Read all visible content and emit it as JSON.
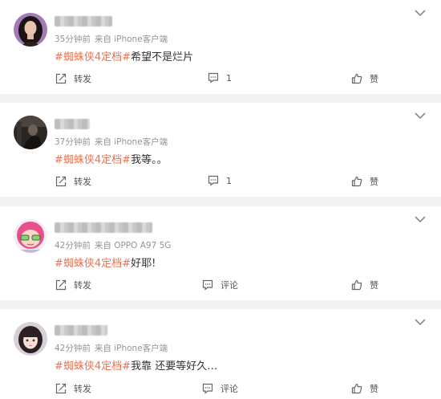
{
  "colors": {
    "hashtag": "#eb7350",
    "meta": "#939393",
    "background": "#f2f2f2"
  },
  "posts": [
    {
      "avatar": "avatar-dark-hair-woman",
      "time": "35分钟前",
      "source": "来自 iPhone客户端",
      "hashtag": "#蜘蛛侠4定档#",
      "text": "希望不是烂片",
      "repost_label": "转发",
      "comment_label": "1",
      "like_label": "赞"
    },
    {
      "avatar": "avatar-dark-figure",
      "time": "37分钟前",
      "source": "来自 iPhone客户端",
      "hashtag": "#蜘蛛侠4定档#",
      "text": "我等。。",
      "repost_label": "转发",
      "comment_label": "1",
      "like_label": "赞"
    },
    {
      "avatar": "avatar-anime-pink-hair",
      "time": "42分钟前",
      "source": "来自 OPPO A97 5G",
      "hashtag": "#蜘蛛侠4定档#",
      "text": "好耶!",
      "repost_label": "转发",
      "comment_label": "评论",
      "like_label": "赞"
    },
    {
      "avatar": "avatar-girl-bangs",
      "time": "42分钟前",
      "source": "来自 iPhone客户端",
      "hashtag": "#蜘蛛侠4定档#",
      "text": "我靠 还要等好久…",
      "repost_label": "转发",
      "comment_label": "评论",
      "like_label": "赞"
    }
  ]
}
